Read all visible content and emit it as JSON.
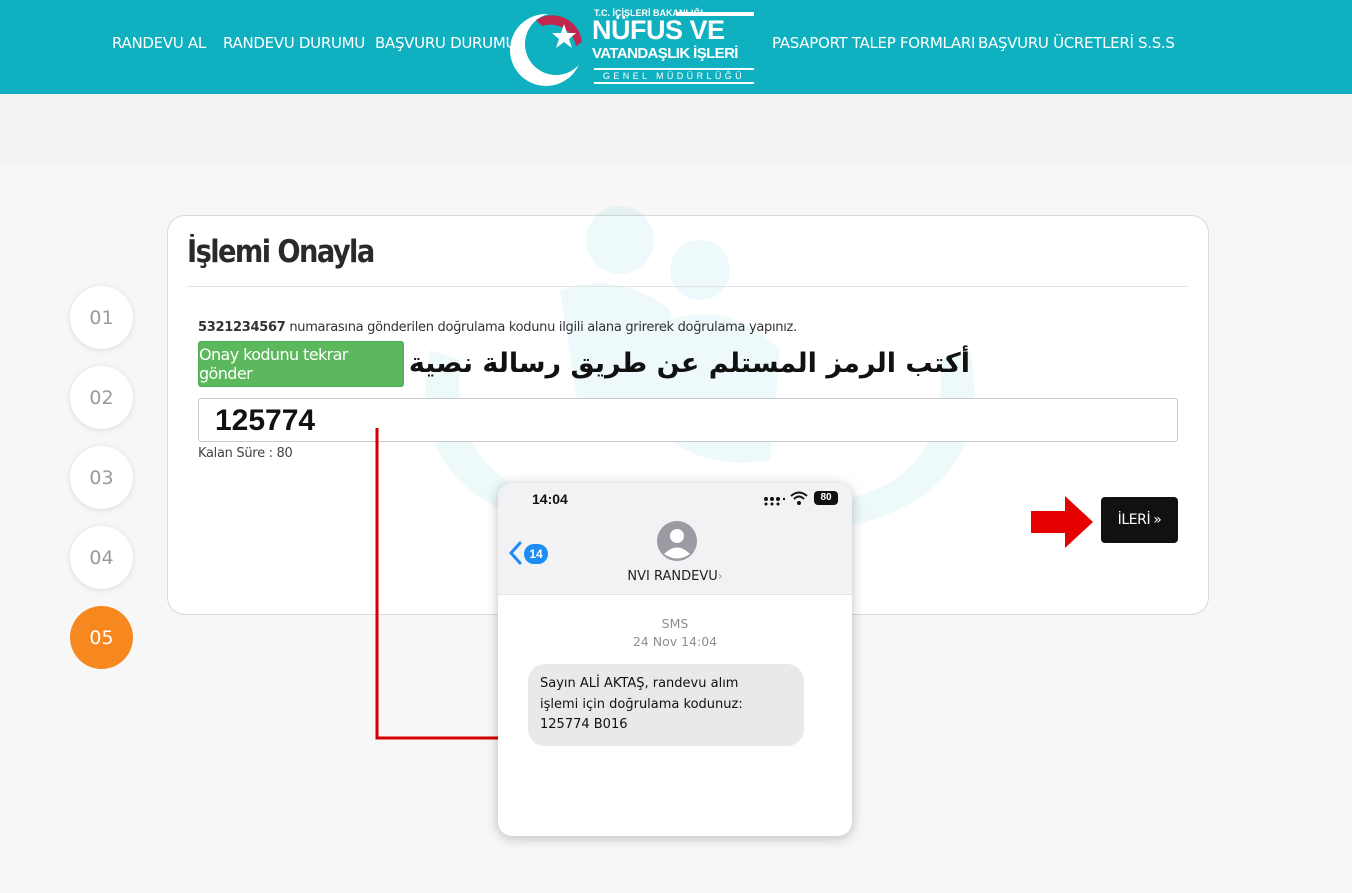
{
  "nav": {
    "left": [
      "RANDEVU AL",
      "RANDEVU DURUMU",
      "BAŞVURU DURUMU"
    ],
    "right": [
      "PASAPORT TALEP FORMLARI",
      "BAŞVURU ÜCRETLERİ",
      "S.S.S"
    ]
  },
  "logo": {
    "ministry": "T.C. İÇİŞLERİ BAKANLIĞI",
    "line1": "NÜFUS VE",
    "line2": "VATANDAŞLIK İŞLERİ",
    "line3": "GENEL MÜDÜRLÜĞÜ"
  },
  "steps": [
    "01",
    "02",
    "03",
    "04",
    "05"
  ],
  "active_step": "05",
  "card": {
    "title": "İşlemi Onayla",
    "phone_number": "5321234567",
    "instruction": "numarasına gönderilen doğrulama kodunu ilgili alana grirerek doğrulama yapınız.",
    "resend_label": "Onay kodunu tekrar gönder",
    "code_value": "125774",
    "timer": "Kalan Süre : 80",
    "next_label": "İLERİ",
    "next_icon": "»"
  },
  "annotation": {
    "arabic_note": "أكتب الرمز المستلم عن طريق رسالة نصية",
    "arrow_color": "#e60000",
    "connector_color": "#d40000"
  },
  "phone": {
    "time": "14:04",
    "battery": "80",
    "unread_count": "14",
    "contact": "NVI RANDEVU",
    "channel": "SMS",
    "date": "24 Nov 14:04",
    "message_line1": "Sayın ALİ AKTAŞ, randevu alım",
    "message_line2": "işlemi için doğrulama kodunuz:",
    "message_line3": "125774 B016"
  },
  "colors": {
    "header": "#0fb0bf",
    "active_step": "#f7871f",
    "resend_button": "#5cb85c",
    "next_button": "#111111"
  }
}
